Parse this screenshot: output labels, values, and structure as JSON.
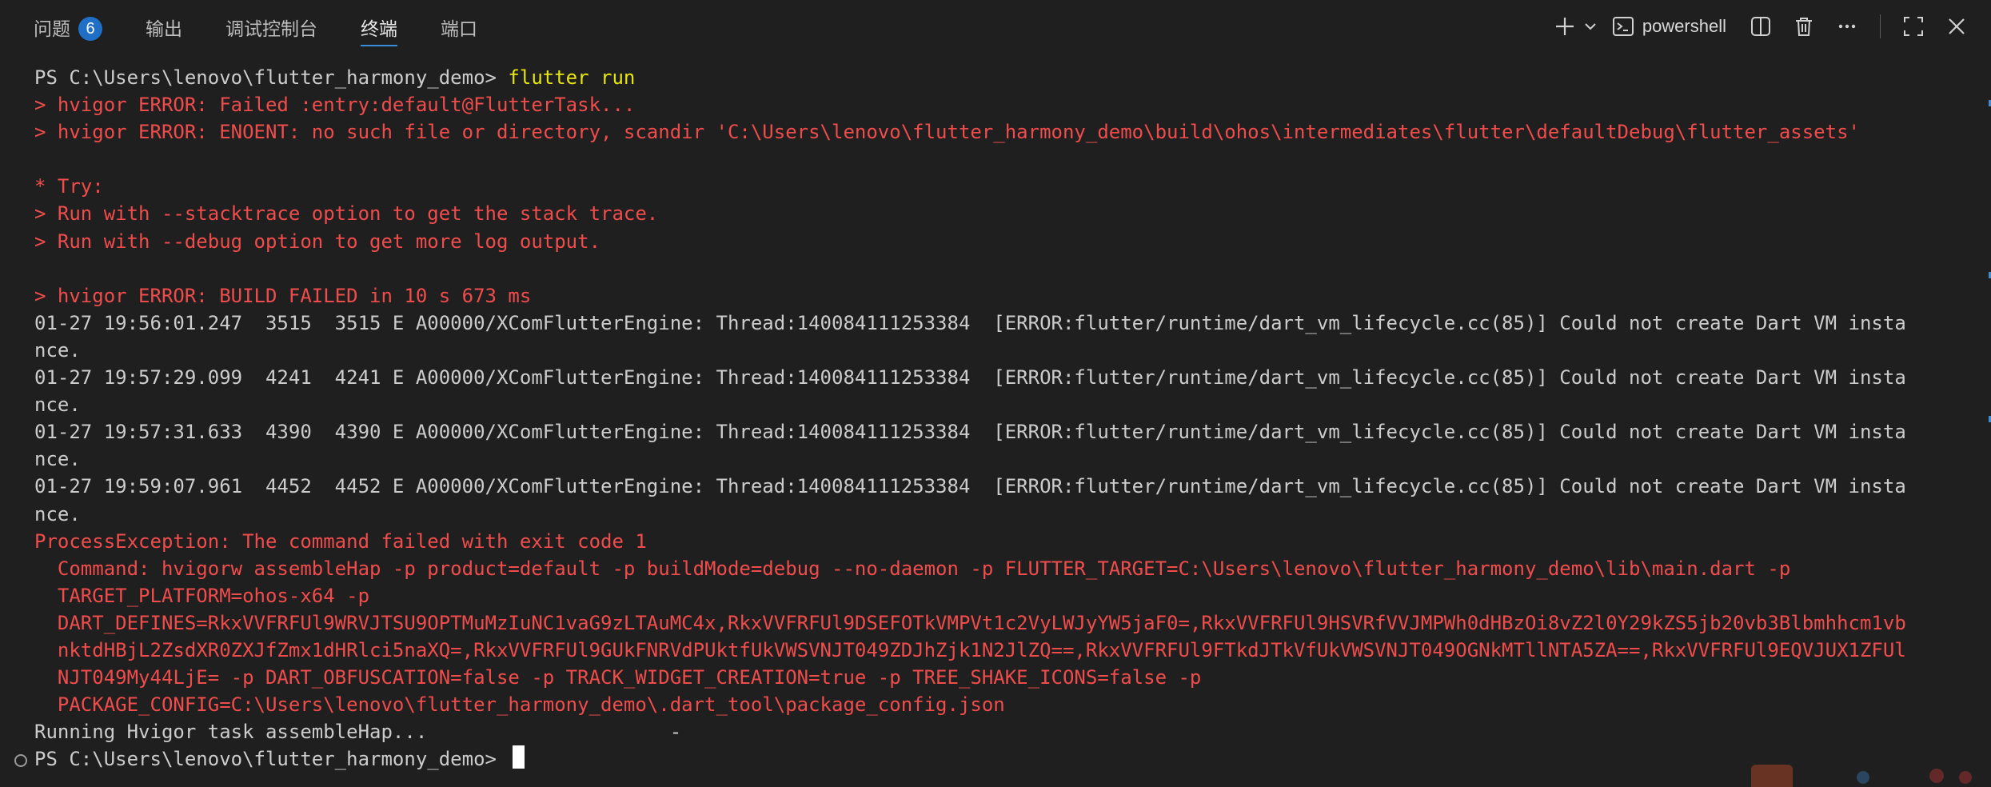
{
  "tabs": [
    {
      "label": "问题",
      "badge": "6"
    },
    {
      "label": "输出"
    },
    {
      "label": "调试控制台"
    },
    {
      "label": "终端"
    },
    {
      "label": "端口"
    }
  ],
  "actions": {
    "terminal_name": "powershell"
  },
  "terminal": {
    "lines": [
      {
        "prompt": "PS C:\\Users\\lenovo\\flutter_harmony_demo> ",
        "command": "flutter run"
      },
      {
        "text": "> hvigor ERROR: Failed :entry:default@FlutterTask...",
        "type": "error"
      },
      {
        "text": "> hvigor ERROR: ENOENT: no such file or directory, scandir 'C:\\Users\\lenovo\\flutter_harmony_demo\\build\\ohos\\intermediates\\flutter\\defaultDebug\\flutter_assets'",
        "type": "error"
      },
      {
        "text": "",
        "type": "normal"
      },
      {
        "text": "* Try:",
        "type": "error"
      },
      {
        "text": "> Run with --stacktrace option to get the stack trace.",
        "type": "error"
      },
      {
        "text": "> Run with --debug option to get more log output.",
        "type": "error"
      },
      {
        "text": "",
        "type": "normal"
      },
      {
        "text": "> hvigor ERROR: BUILD FAILED in 10 s 673 ms",
        "type": "error"
      },
      {
        "text": "01-27 19:56:01.247  3515  3515 E A00000/XComFlutterEngine: Thread:140084111253384  [ERROR:flutter/runtime/dart_vm_lifecycle.cc(85)] Could not create Dart VM insta",
        "type": "normal"
      },
      {
        "text": "nce.",
        "type": "normal"
      },
      {
        "text": "01-27 19:57:29.099  4241  4241 E A00000/XComFlutterEngine: Thread:140084111253384  [ERROR:flutter/runtime/dart_vm_lifecycle.cc(85)] Could not create Dart VM insta",
        "type": "normal"
      },
      {
        "text": "nce.",
        "type": "normal"
      },
      {
        "text": "01-27 19:57:31.633  4390  4390 E A00000/XComFlutterEngine: Thread:140084111253384  [ERROR:flutter/runtime/dart_vm_lifecycle.cc(85)] Could not create Dart VM insta",
        "type": "normal"
      },
      {
        "text": "nce.",
        "type": "normal"
      },
      {
        "text": "01-27 19:59:07.961  4452  4452 E A00000/XComFlutterEngine: Thread:140084111253384  [ERROR:flutter/runtime/dart_vm_lifecycle.cc(85)] Could not create Dart VM insta",
        "type": "normal"
      },
      {
        "text": "nce.",
        "type": "normal"
      },
      {
        "text": "ProcessException: The command failed with exit code 1",
        "type": "error"
      },
      {
        "text": "  Command: hvigorw assembleHap -p product=default -p buildMode=debug --no-daemon -p FLUTTER_TARGET=C:\\Users\\lenovo\\flutter_harmony_demo\\lib\\main.dart -p",
        "type": "error"
      },
      {
        "text": "  TARGET_PLATFORM=ohos-x64 -p",
        "type": "error"
      },
      {
        "text": "  DART_DEFINES=RkxVVFRFUl9WRVJTSU9OPTMuMzIuNC1vaG9zLTAuMC4x,RkxVVFRFUl9DSEFOTkVMPVt1c2VyLWJyYW5jaF0=,RkxVVFRFUl9HSVRfVVJMPWh0dHBzOi8vZ2l0Y29kZS5jb20vb3Blbmhhcm1vb",
        "type": "error"
      },
      {
        "text": "  nktdHBjL2ZsdXR0ZXJfZmx1dHRlci5naXQ=,RkxVVFRFUl9GUkFNRVdPUktfUkVWSVNJT049ZDJhZjk1N2JlZQ==,RkxVVFRFUl9FTkdJTkVfUkVWSVNJT049OGNkMTllNTA5ZA==,RkxVVFRFUl9EQVJUX1ZFUl",
        "type": "error"
      },
      {
        "text": "  NJT049My44LjE= -p DART_OBFUSCATION=false -p TRACK_WIDGET_CREATION=true -p TREE_SHAKE_ICONS=false -p",
        "type": "error"
      },
      {
        "text": "  PACKAGE_CONFIG=C:\\Users\\lenovo\\flutter_harmony_demo\\.dart_tool\\package_config.json",
        "type": "error"
      },
      {
        "text": "Running Hvigor task assembleHap...                     -",
        "type": "normal"
      },
      {
        "prompt": "PS C:\\Users\\lenovo\\flutter_harmony_demo> ",
        "command": "",
        "cursor": true
      }
    ]
  },
  "colors": {
    "background": "#1f1f1f",
    "error": "#f14c4c",
    "command": "#e5e510",
    "text": "#cccccc",
    "accent": "#3c8dd8"
  }
}
